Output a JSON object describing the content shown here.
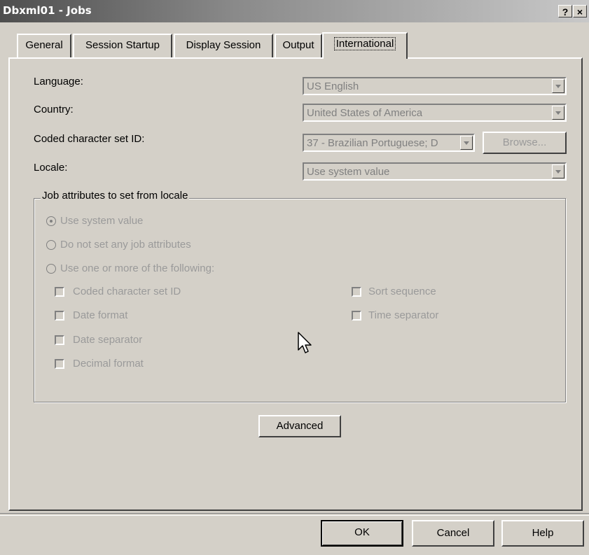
{
  "window": {
    "title": "Dbxml01 - Jobs",
    "help_btn": "?",
    "close_btn": "×"
  },
  "tabs": [
    {
      "label": "General"
    },
    {
      "label": "Session Startup"
    },
    {
      "label": "Display Session"
    },
    {
      "label": "Output"
    },
    {
      "label": "International"
    }
  ],
  "fields": {
    "language_label": "Language:",
    "language_value": "US English",
    "country_label": "Country:",
    "country_value": "United States of America",
    "ccsid_label": "Coded character set ID:",
    "ccsid_value": "37 - Brazilian Portuguese; D",
    "browse_label": "Browse...",
    "locale_label": "Locale:",
    "locale_value": "Use system value"
  },
  "group": {
    "title": "Job attributes to set from locale",
    "radios": [
      {
        "label": "Use system value",
        "selected": true
      },
      {
        "label": "Do not set any job attributes",
        "selected": false
      },
      {
        "label": "Use one or more of the following:",
        "selected": false
      }
    ],
    "checks_left": [
      {
        "label": "Coded character set ID"
      },
      {
        "label": "Date format"
      },
      {
        "label": "Date separator"
      },
      {
        "label": "Decimal format"
      }
    ],
    "checks_right": [
      {
        "label": "Sort sequence"
      },
      {
        "label": "Time separator"
      }
    ]
  },
  "advanced_label": "Advanced",
  "footer": {
    "ok": "OK",
    "cancel": "Cancel",
    "help": "Help"
  }
}
